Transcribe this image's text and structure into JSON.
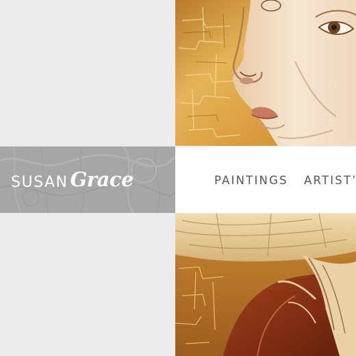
{
  "logo": {
    "first_name": "SUSAN",
    "last_name": "Grace"
  },
  "nav": {
    "items": [
      {
        "label": "PAINTINGS"
      },
      {
        "label": "ARTIST’"
      }
    ]
  },
  "colors": {
    "background": "#ececec",
    "logo_band": "#a7a7a7",
    "nav_band": "#ffffff",
    "nav_text": "#555555",
    "painting_gold": "#d9a446",
    "painting_rust": "#8a3216"
  }
}
